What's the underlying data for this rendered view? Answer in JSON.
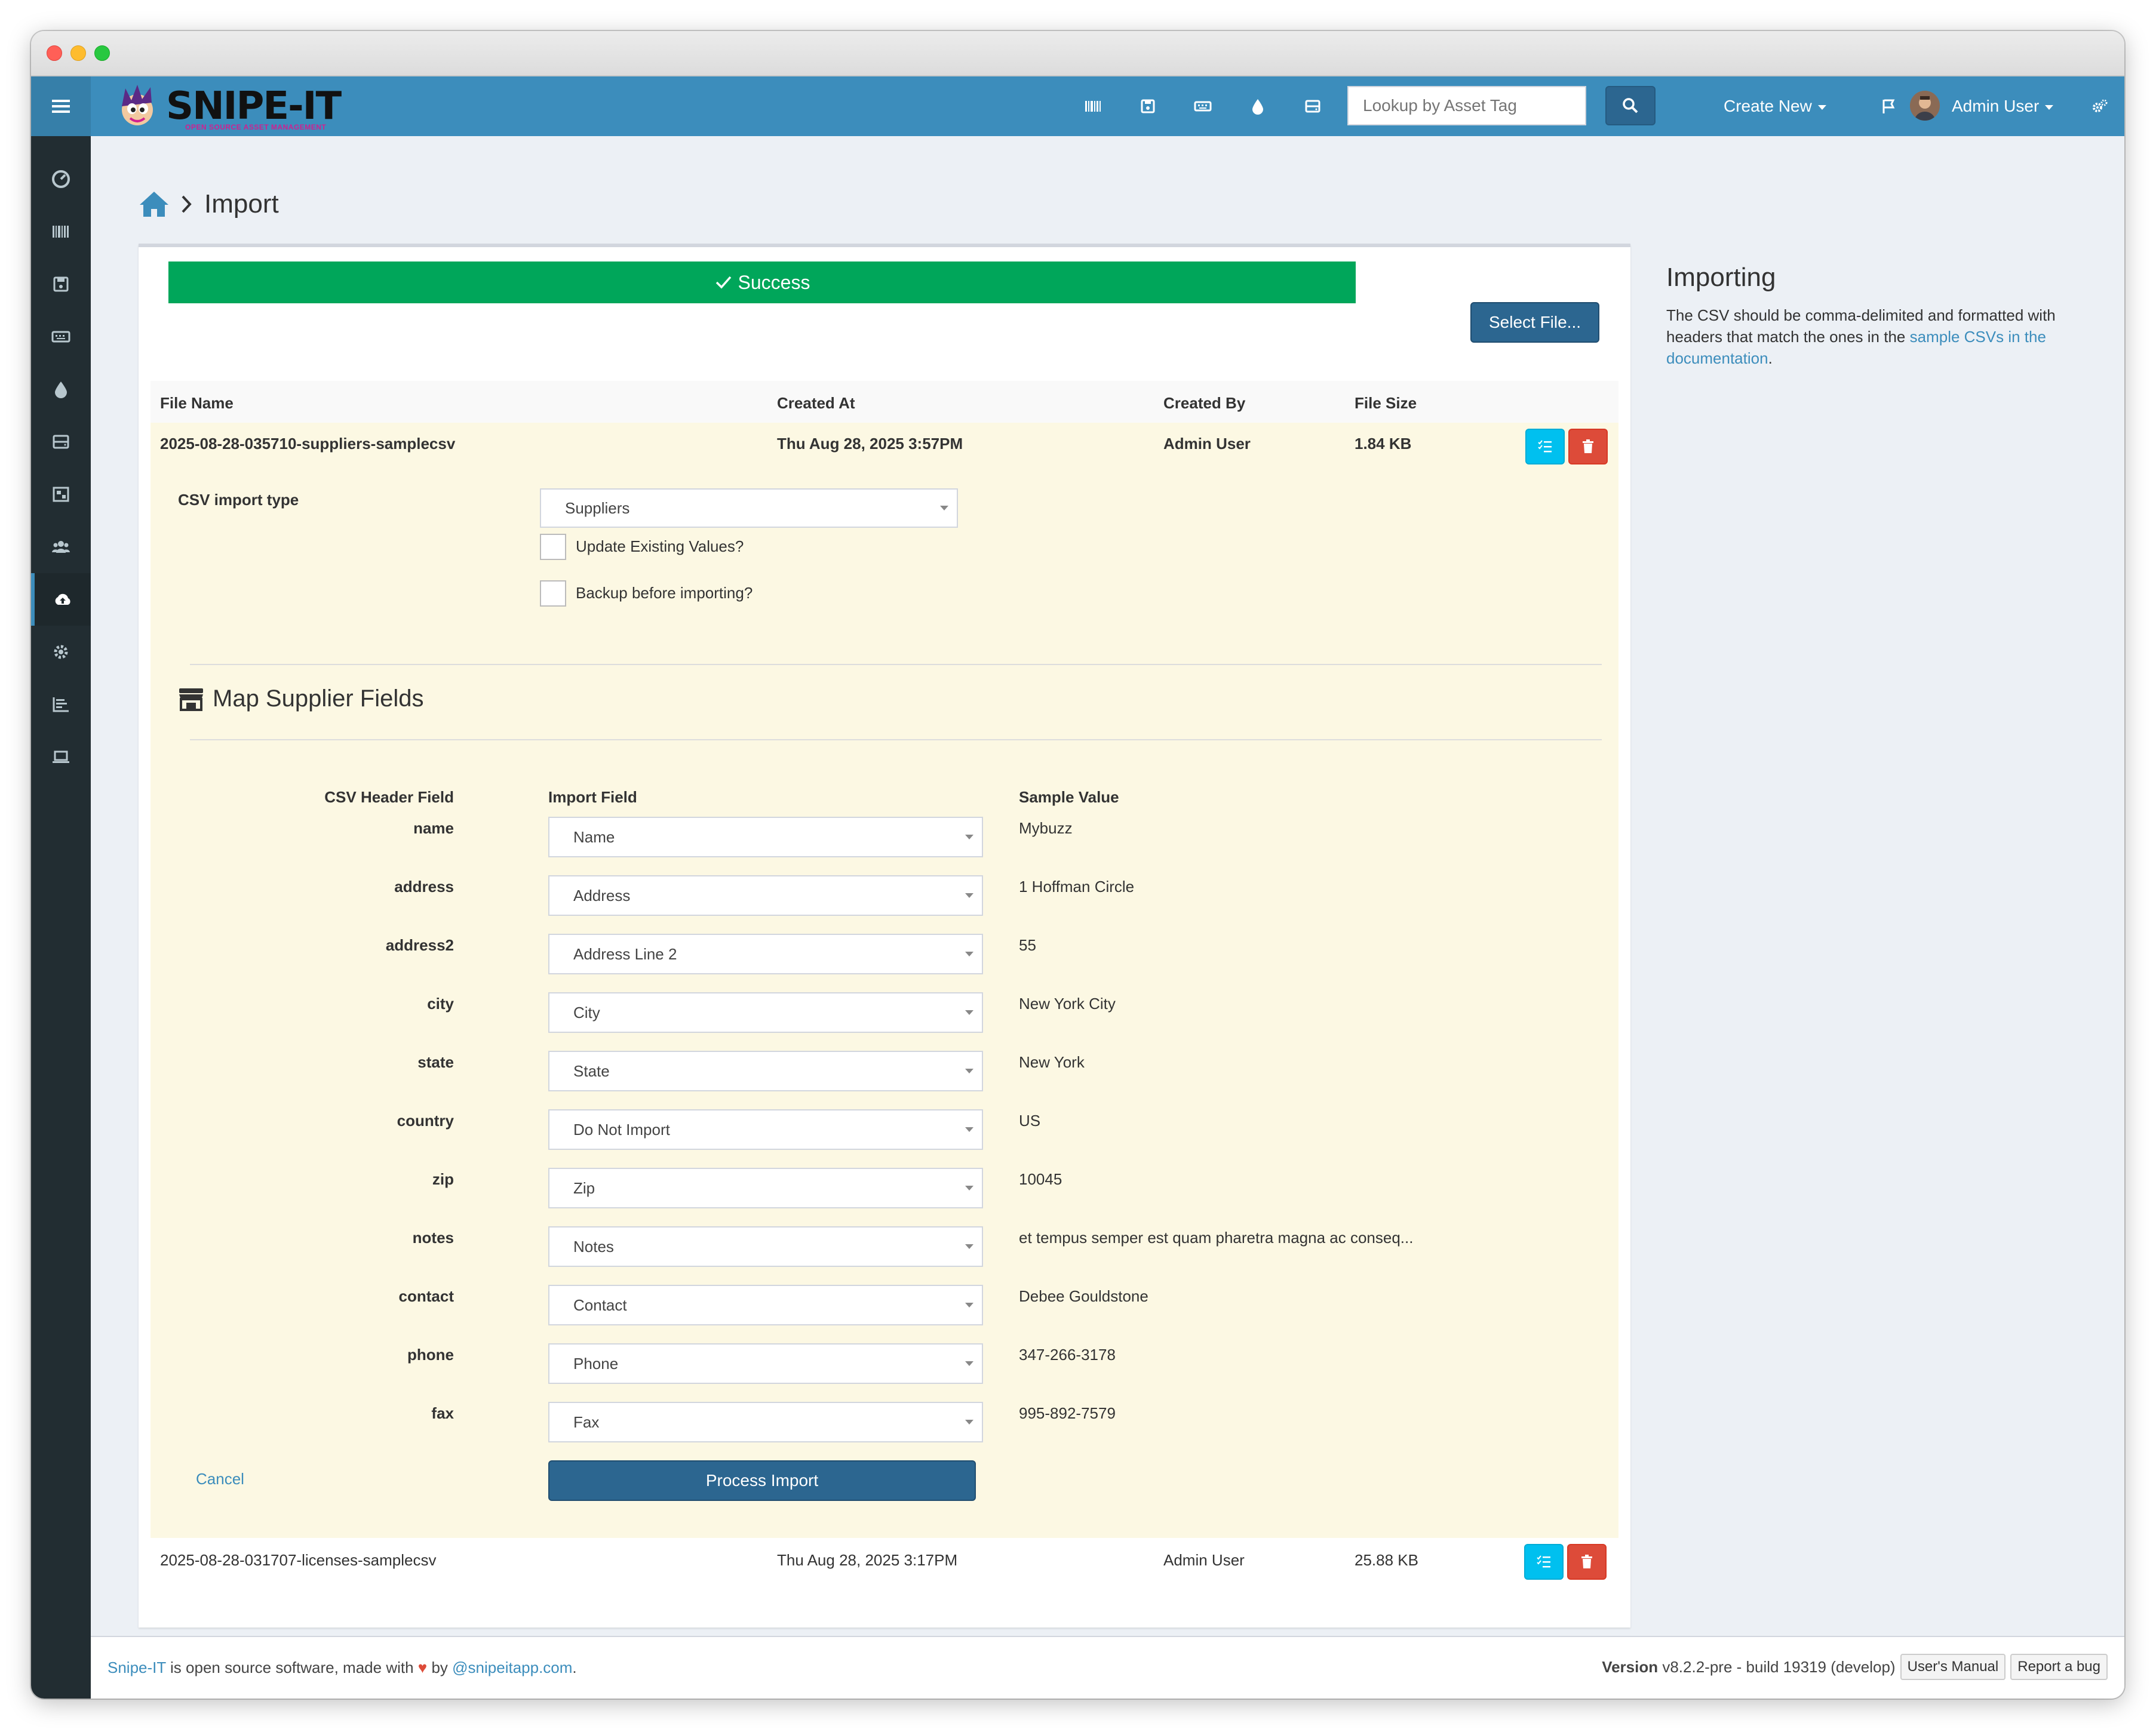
{
  "navbar": {
    "logo_text": "SNIPE-IT",
    "logo_subtitle": "OPEN SOURCE ASSET MANAGEMENT",
    "search_placeholder": "Lookup by Asset Tag",
    "create_new": "Create New",
    "user_name": "Admin User",
    "icons": [
      "barcode-icon",
      "disk-icon",
      "keyboard-icon",
      "drop-icon",
      "server-icon"
    ]
  },
  "sidebar": {
    "items": [
      "dashboard-icon",
      "barcode-icon",
      "disk-icon",
      "keyboard-icon",
      "drop-icon",
      "server-icon",
      "kit-icon",
      "users-icon",
      "cloud-upload-icon",
      "settings-icon",
      "reports-icon",
      "laptop-icon"
    ],
    "active": "cloud-upload-icon"
  },
  "page": {
    "title": "Import"
  },
  "import": {
    "success_message": "Success",
    "select_file_label": "Select File...",
    "columns": {
      "file_name": "File Name",
      "created_at": "Created At",
      "created_by": "Created By",
      "file_size": "File Size"
    },
    "files": [
      {
        "file_name": "2025-08-28-035710-suppliers-samplecsv",
        "created_at": "Thu Aug 28, 2025 3:57PM",
        "created_by": "Admin User",
        "file_size": "1.84 KB"
      },
      {
        "file_name": "2025-08-28-031707-licenses-samplecsv",
        "created_at": "Thu Aug 28, 2025 3:17PM",
        "created_by": "Admin User",
        "file_size": "25.88 KB"
      }
    ],
    "csv_import_type_label": "CSV import type",
    "csv_import_type_value": "Suppliers",
    "update_existing_label": "Update Existing Values?",
    "backup_label": "Backup before importing?",
    "map_title": "Map Supplier Fields",
    "map_columns": {
      "header_field": "CSV Header Field",
      "import_field": "Import Field",
      "sample_value": "Sample Value"
    },
    "mappings": [
      {
        "header": "name",
        "field": "Name",
        "sample": "Mybuzz"
      },
      {
        "header": "address",
        "field": "Address",
        "sample": "1 Hoffman Circle"
      },
      {
        "header": "address2",
        "field": "Address Line 2",
        "sample": "55"
      },
      {
        "header": "city",
        "field": "City",
        "sample": "New York City"
      },
      {
        "header": "state",
        "field": "State",
        "sample": "New York"
      },
      {
        "header": "country",
        "field": "Do Not Import",
        "sample": "US"
      },
      {
        "header": "zip",
        "field": "Zip",
        "sample": "10045"
      },
      {
        "header": "notes",
        "field": "Notes",
        "sample": "et tempus semper est quam pharetra magna ac conseq..."
      },
      {
        "header": "contact",
        "field": "Contact",
        "sample": "Debee Gouldstone"
      },
      {
        "header": "phone",
        "field": "Phone",
        "sample": "347-266-3178"
      },
      {
        "header": "fax",
        "field": "Fax",
        "sample": "995-892-7579"
      }
    ],
    "cancel_label": "Cancel",
    "process_label": "Process Import"
  },
  "info": {
    "title": "Importing",
    "text_before": "The CSV should be comma-delimited and formatted with headers that match the ones in the ",
    "link_text": "sample CSVs in the documentation",
    "text_after": "."
  },
  "footer": {
    "brand_link": "Snipe-IT",
    "text_mid": " is open source software, made with ",
    "text_by": " by ",
    "author_link": "@snipeitapp.com",
    "text_end": ".",
    "version_label": "Version",
    "version_value": " v8.2.2-pre - build 19319 (develop)",
    "manual_label": "User's Manual",
    "bug_label": "Report a bug"
  },
  "colors": {
    "navbar": "#3c8dbc",
    "sidebar": "#222d32",
    "success": "#00a65a",
    "primary": "#2c6690",
    "info": "#00c0ef",
    "danger": "#dd4b39",
    "row_highlight": "#fcf8e3"
  }
}
